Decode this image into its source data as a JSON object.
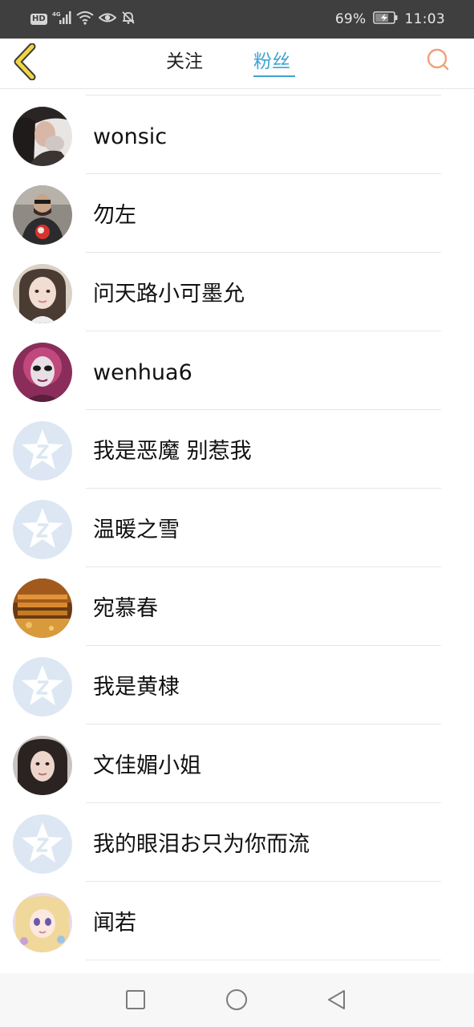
{
  "status_bar": {
    "hd_label": "HD",
    "network_label": "4G",
    "battery_percent": "69%",
    "time": "11:03",
    "icons": [
      "signal-icon",
      "wifi-icon",
      "eye-icon",
      "bell-muted-icon",
      "battery-charging-icon"
    ]
  },
  "nav": {
    "back_icon": "back-chevron-icon",
    "tab_follow": "关注",
    "tab_fans": "粉丝",
    "active_tab": "粉丝",
    "search_icon": "search-icon",
    "accent_color": "#3ea4d3",
    "back_color": "#f2d544",
    "search_color": "#f0a07a"
  },
  "fans": [
    {
      "name": "wonsic",
      "avatar": "photo"
    },
    {
      "name": "勿左",
      "avatar": "photo"
    },
    {
      "name": "问天路小可墨允",
      "avatar": "photo"
    },
    {
      "name": "wenhua6",
      "avatar": "photo"
    },
    {
      "name": "我是恶魔 别惹我",
      "avatar": "default"
    },
    {
      "name": "温暖之雪",
      "avatar": "default"
    },
    {
      "name": "宛慕春",
      "avatar": "photo"
    },
    {
      "name": "我是黄棣",
      "avatar": "default"
    },
    {
      "name": "文佳媚小姐",
      "avatar": "photo"
    },
    {
      "name": "我的眼泪お只为你而流",
      "avatar": "default"
    },
    {
      "name": "闻若",
      "avatar": "photo"
    }
  ],
  "system_nav": {
    "icons": [
      "recent-apps-icon",
      "home-icon",
      "back-triangle-icon"
    ]
  }
}
